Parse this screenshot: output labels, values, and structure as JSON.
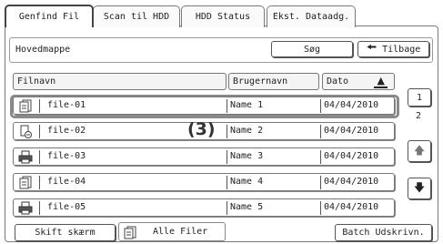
{
  "tabs": [
    {
      "label": "Genfind Fil"
    },
    {
      "label": "Scan til HDD"
    },
    {
      "label": "HDD Status"
    },
    {
      "label": "Ekst. Dataadg."
    }
  ],
  "path": {
    "folder": "Hovedmappe",
    "search_label": "Søg",
    "back_label": "Tilbage"
  },
  "columns": {
    "name": "Filnavn",
    "user": "Brugernavn",
    "date": "Dato"
  },
  "rows": [
    {
      "name": "file-01",
      "user": "Name 1",
      "date": "04/04/2010",
      "icon": "file-icon"
    },
    {
      "name": "file-02",
      "user": "Name 2",
      "date": "04/04/2010",
      "icon": "locked-file-icon"
    },
    {
      "name": "file-03",
      "user": "Name 3",
      "date": "04/04/2010",
      "icon": "printer-file-icon"
    },
    {
      "name": "file-04",
      "user": "Name 4",
      "date": "04/04/2010",
      "icon": "file-icon"
    },
    {
      "name": "file-05",
      "user": "Name 5",
      "date": "04/04/2010",
      "icon": "printer-file-icon"
    }
  ],
  "pagination": {
    "current": "1",
    "total": "2"
  },
  "annotation": "(3)",
  "footer": {
    "switch_label": "Skift skærm",
    "filter_label": "Alle Filer",
    "batch_label": "Batch Udskrivn."
  }
}
